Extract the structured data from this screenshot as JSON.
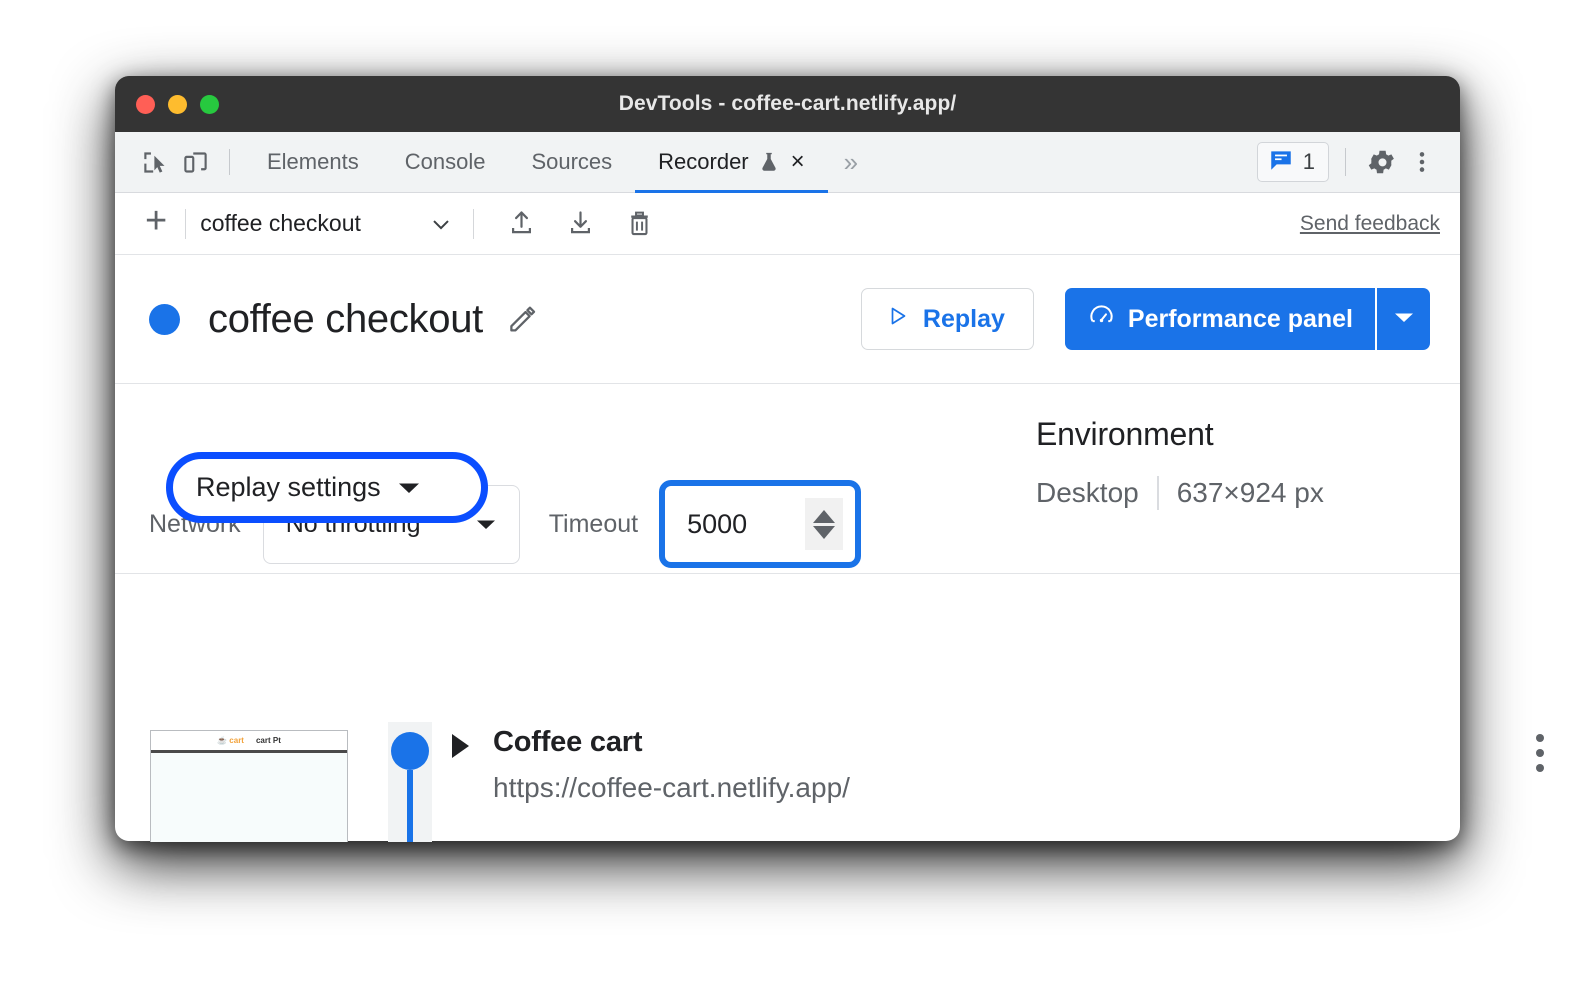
{
  "window": {
    "title": "DevTools - coffee-cart.netlify.app/",
    "traffic_lights": [
      "close",
      "minimize",
      "maximize"
    ]
  },
  "tabbar": {
    "inspect_icon": "inspect-element-icon",
    "device_icon": "device-toolbar-icon",
    "tabs": [
      {
        "label": "Elements",
        "active": false
      },
      {
        "label": "Console",
        "active": false
      },
      {
        "label": "Sources",
        "active": false
      },
      {
        "label": "Recorder",
        "active": true,
        "experimental": true,
        "closable": true
      }
    ],
    "more_tabs": "»",
    "close_symbol": "×",
    "issues": {
      "icon": "issues-message-icon",
      "count": "1"
    },
    "settings_icon": "gear-icon",
    "menu_icon": "kebab-menu-icon"
  },
  "recorder_toolbar": {
    "add_label": "+",
    "recording_name": "coffee checkout",
    "dropdown_icon": "chevron-down-icon",
    "export_icon": "export-icon",
    "import_icon": "import-icon",
    "delete_icon": "trash-icon",
    "feedback_label": "Send feedback"
  },
  "header": {
    "status_dot_color": "#1a73e8",
    "title": "coffee checkout",
    "edit_icon": "pencil-icon",
    "replay_label": "Replay",
    "replay_icon": "play-triangle-icon",
    "performance_label": "Performance panel",
    "performance_icon": "performance-gauge-icon",
    "performance_caret": "caret-down-icon"
  },
  "settings": {
    "replay_settings_label": "Replay settings",
    "replay_settings_caret": "caret-down-icon",
    "highlight_color": "#0b4eff",
    "network_label": "Network",
    "network_value": "No throttling",
    "timeout_label": "Timeout",
    "timeout_value": "5000",
    "timeout_focus_color": "#1a73e8",
    "environment_title": "Environment",
    "environment_device": "Desktop",
    "environment_viewport": "637×924 px"
  },
  "steps": [
    {
      "title": "Coffee cart",
      "url": "https://coffee-cart.netlify.app/",
      "expand_icon": "caret-right-icon",
      "menu_icon": "kebab-menu-icon",
      "thumbnail_logo": "☕ cart",
      "thumbnail_text": "cart Pt"
    }
  ]
}
